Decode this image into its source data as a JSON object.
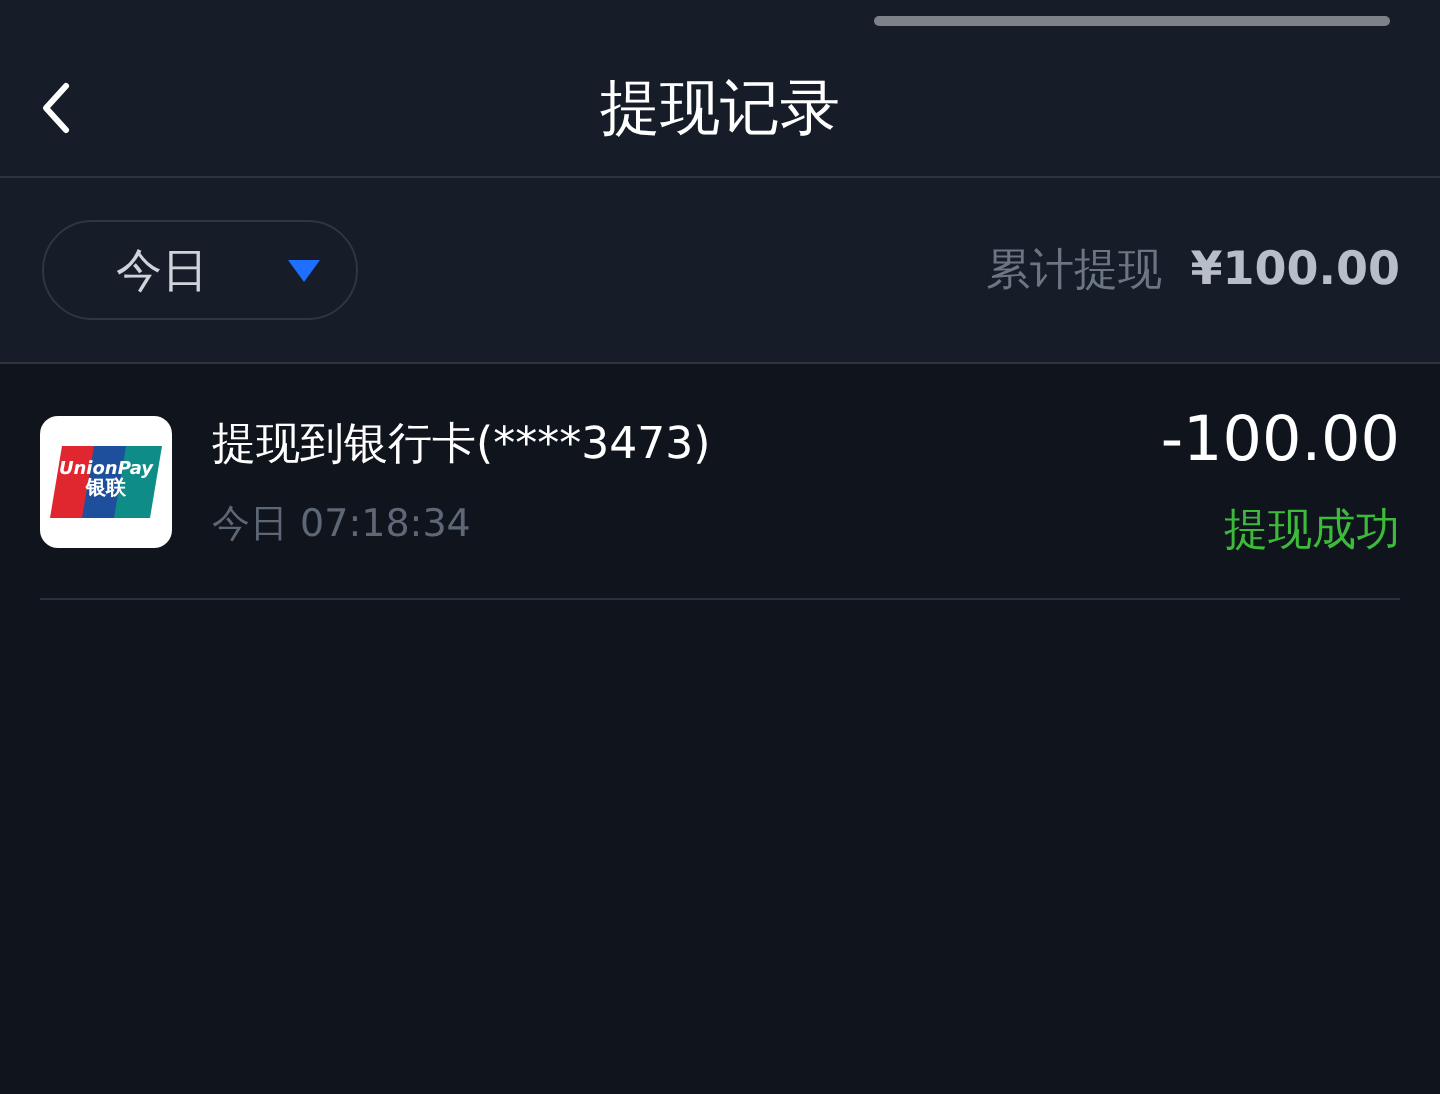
{
  "nav": {
    "title": "提现记录"
  },
  "filter": {
    "label": "今日",
    "summary_label": "累计提现",
    "summary_value": "¥100.00"
  },
  "records": [
    {
      "logo": {
        "top": "UnionPay",
        "bottom": "银联"
      },
      "title": "提现到银行卡(****3473)",
      "time": "今日 07:18:34",
      "amount": "-100.00",
      "status": "提现成功",
      "kind": "success"
    }
  ]
}
